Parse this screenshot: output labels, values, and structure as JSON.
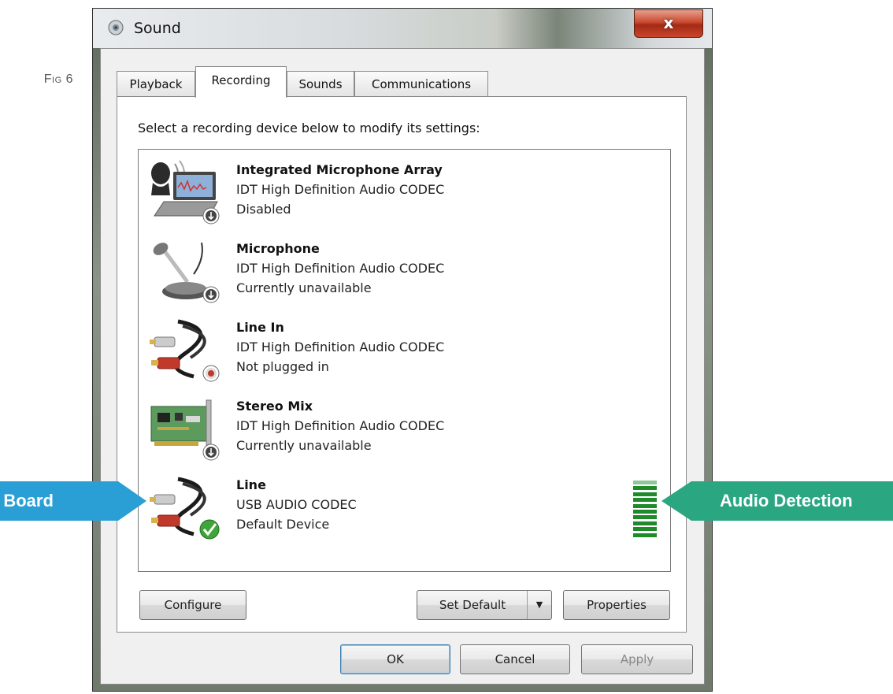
{
  "figure_label": "Fig 6",
  "window": {
    "title": "Sound",
    "close_label": "x"
  },
  "tabs": [
    {
      "label": "Playback"
    },
    {
      "label": "Recording",
      "active": true
    },
    {
      "label": "Sounds"
    },
    {
      "label": "Communications"
    }
  ],
  "instruction": "Select a recording device below to modify its settings:",
  "devices": [
    {
      "name": "Integrated Microphone Array",
      "driver": "IDT High Definition Audio CODEC",
      "status": "Disabled",
      "icon": "microphone-array-laptop-icon",
      "badge": "down-arrow-badge"
    },
    {
      "name": "Microphone",
      "driver": "IDT High Definition Audio CODEC",
      "status": "Currently unavailable",
      "icon": "desk-microphone-icon",
      "badge": "down-arrow-badge"
    },
    {
      "name": "Line In",
      "driver": "IDT High Definition Audio CODEC",
      "status": "Not plugged in",
      "icon": "rca-cable-icon",
      "badge": "red-dot-badge"
    },
    {
      "name": "Stereo Mix",
      "driver": "IDT High Definition Audio CODEC",
      "status": "Currently unavailable",
      "icon": "sound-card-icon",
      "badge": "down-arrow-badge"
    },
    {
      "name": "Line",
      "driver": "USB AUDIO  CODEC",
      "status": "Default Device",
      "icon": "rca-cable-icon",
      "badge": "green-check-badge"
    }
  ],
  "level_meter": {
    "device": "Line",
    "level": 0.85
  },
  "buttons": {
    "configure": "Configure",
    "set_default": "Set Default",
    "properties": "Properties",
    "ok": "OK",
    "cancel": "Cancel",
    "apply": "Apply"
  },
  "callouts": {
    "left": "e Board",
    "right": "Audio Detection"
  },
  "colors": {
    "callout_left": "#2a9fd6",
    "callout_right": "#2aa681",
    "meter_green": "#1f8a2a",
    "close_red": "#c8492f"
  }
}
